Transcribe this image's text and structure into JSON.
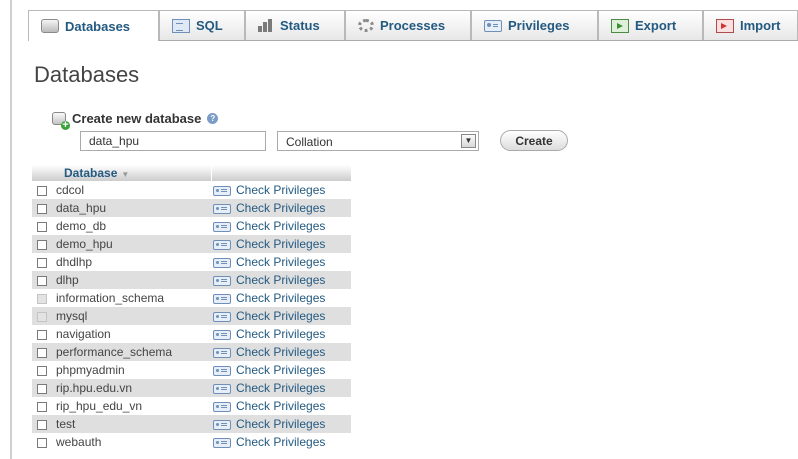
{
  "tabs": [
    {
      "label": "Databases",
      "icon": "database-icon",
      "active": true
    },
    {
      "label": "SQL",
      "icon": "sql-icon",
      "active": false
    },
    {
      "label": "Status",
      "icon": "status-icon",
      "active": false
    },
    {
      "label": "Processes",
      "icon": "processes-icon",
      "active": false
    },
    {
      "label": "Privileges",
      "icon": "privileges-icon",
      "active": false
    },
    {
      "label": "Export",
      "icon": "export-icon",
      "active": false
    },
    {
      "label": "Import",
      "icon": "import-icon",
      "active": false
    }
  ],
  "page": {
    "title": "Databases"
  },
  "create_db": {
    "label": "Create new database",
    "name_value": "data_hpu",
    "collation_selected": "Collation",
    "create_button": "Create"
  },
  "table": {
    "header_database": "Database",
    "header_action": "",
    "check_privileges_label": "Check Privileges",
    "rows": [
      {
        "name": "cdcol",
        "checkbox_enabled": true
      },
      {
        "name": "data_hpu",
        "checkbox_enabled": true
      },
      {
        "name": "demo_db",
        "checkbox_enabled": true
      },
      {
        "name": "demo_hpu",
        "checkbox_enabled": true
      },
      {
        "name": "dhdlhp",
        "checkbox_enabled": true
      },
      {
        "name": "dlhp",
        "checkbox_enabled": true
      },
      {
        "name": "information_schema",
        "checkbox_enabled": false
      },
      {
        "name": "mysql",
        "checkbox_enabled": false
      },
      {
        "name": "navigation",
        "checkbox_enabled": true
      },
      {
        "name": "performance_schema",
        "checkbox_enabled": true
      },
      {
        "name": "phpmyadmin",
        "checkbox_enabled": true
      },
      {
        "name": "rip.hpu.edu.vn",
        "checkbox_enabled": true
      },
      {
        "name": "rip_hpu_edu_vn",
        "checkbox_enabled": true
      },
      {
        "name": "test",
        "checkbox_enabled": true
      },
      {
        "name": "webauth",
        "checkbox_enabled": true
      }
    ]
  },
  "colors": {
    "link": "#235a81",
    "row_alt": "#dfdfdf",
    "text": "#444444"
  }
}
